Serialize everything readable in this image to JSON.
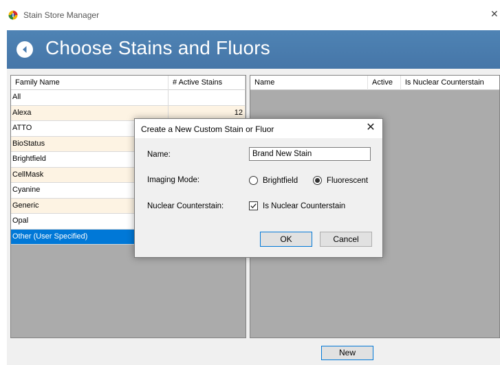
{
  "window": {
    "title": "Stain Store Manager",
    "close_glyph": "✕"
  },
  "header": {
    "title": "Choose Stains and Fluors",
    "back_icon": "back-arrow-icon",
    "background_color": "#4a7cb0"
  },
  "family_grid": {
    "columns": [
      "Family Name",
      "# Active Stains"
    ],
    "rows": [
      {
        "name": "All",
        "active": ""
      },
      {
        "name": "Alexa",
        "active": "12"
      },
      {
        "name": "ATTO",
        "active": ""
      },
      {
        "name": "BioStatus",
        "active": ""
      },
      {
        "name": "Brightfield",
        "active": ""
      },
      {
        "name": "CellMask",
        "active": ""
      },
      {
        "name": "Cyanine",
        "active": ""
      },
      {
        "name": "Generic",
        "active": ""
      },
      {
        "name": "Opal",
        "active": ""
      },
      {
        "name": "Other (User Specified)",
        "active": ""
      }
    ],
    "selected_index": 9
  },
  "stain_grid": {
    "columns": [
      "Name",
      "Active",
      "Is Nuclear Counterstain"
    ]
  },
  "buttons": {
    "new_label": "New"
  },
  "dialog": {
    "title": "Create a New Custom Stain or Fluor",
    "close_glyph": "✕",
    "name_label": "Name:",
    "name_value": "Brand New Stain",
    "imaging_mode_label": "Imaging Mode:",
    "brightfield_label": "Brightfield",
    "fluorescent_label": "Fluorescent",
    "imaging_mode_selected": "Fluorescent",
    "counterstain_label": "Nuclear Counterstain:",
    "counterstain_checkbox_label": "Is Nuclear Counterstain",
    "counterstain_checked": true,
    "ok_label": "OK",
    "cancel_label": "Cancel"
  },
  "colors": {
    "selection": "#0078d7",
    "alt_row": "#fdf3e3",
    "grid_empty": "#ababab"
  }
}
